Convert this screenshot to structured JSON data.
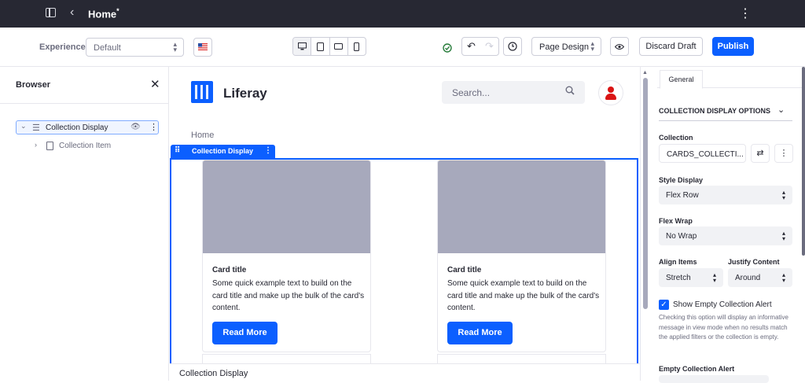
{
  "topbar": {
    "title": "Home",
    "draft_mark": "*",
    "back_icon": "‹",
    "menu_icon": "⋮"
  },
  "toolbar": {
    "experience_label": "Experience",
    "experience_value": "Default",
    "language_flag": "en-US",
    "device_modes": [
      "desktop",
      "tablet",
      "landscape",
      "phone"
    ],
    "active_device": "desktop",
    "page_design_label": "Page Design",
    "discard_label": "Discard Draft",
    "publish_label": "Publish"
  },
  "sidebar": {
    "title": "Browser",
    "tree": [
      {
        "label": "Collection Display",
        "expanded": true,
        "selected": true
      },
      {
        "label": "Collection Item",
        "expanded": false
      }
    ]
  },
  "page": {
    "brand": "Liferay",
    "search_placeholder": "Search...",
    "breadcrumb_home": "Home",
    "fragment_label": "Collection Display",
    "cards": [
      {
        "title": "Card title",
        "text": "Some quick example text to build on the card title and make up the bulk of the card's content.",
        "button": "Read More"
      },
      {
        "title": "Card title",
        "text": "Some quick example text to build on the card title and make up the bulk of the card's content.",
        "button": "Read More"
      }
    ],
    "bottom_label": "Collection Display"
  },
  "config": {
    "tab": "General",
    "section_title": "COLLECTION DISPLAY OPTIONS",
    "collection_label": "Collection",
    "collection_value": "CARDS_COLLECTI...",
    "style_display_label": "Style Display",
    "style_display_value": "Flex Row",
    "flex_wrap_label": "Flex Wrap",
    "flex_wrap_value": "No Wrap",
    "align_items_label": "Align Items",
    "align_items_value": "Stretch",
    "justify_content_label": "Justify Content",
    "justify_content_value": "Around",
    "show_empty_label": "Show Empty Collection Alert",
    "show_empty_checked": true,
    "help_text": "Checking this option will display an informative message in view mode when no results match the applied filters or the collection is empty.",
    "empty_alert_label": "Empty Collection Alert"
  },
  "colors": {
    "primary": "#0b5fff",
    "topbar": "#272833",
    "placeholder": "#a7a9bc",
    "avatar": "#da1414",
    "success": "#287d3c"
  }
}
